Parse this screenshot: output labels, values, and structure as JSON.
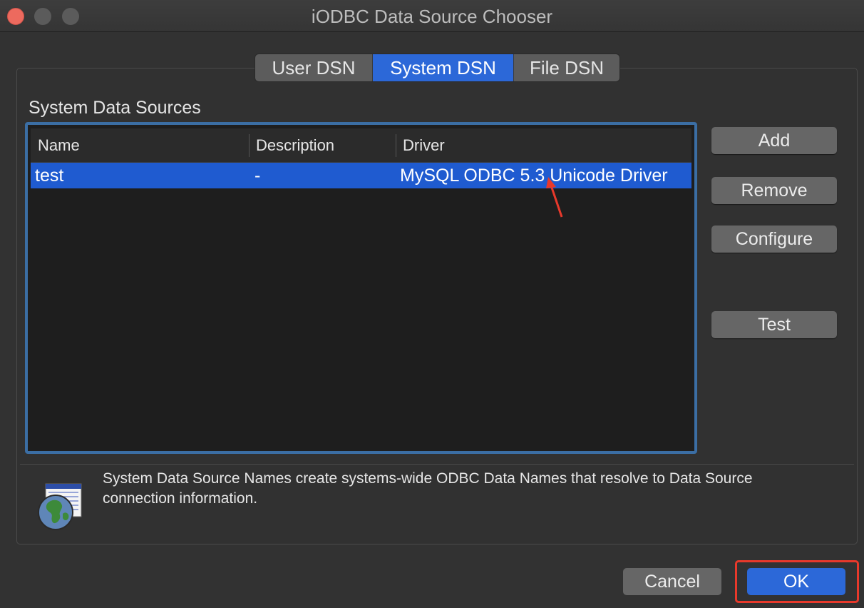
{
  "window": {
    "title": "iODBC Data Source Chooser"
  },
  "tabs": [
    {
      "label": "User DSN",
      "selected": false
    },
    {
      "label": "System DSN",
      "selected": true
    },
    {
      "label": "File DSN",
      "selected": false
    }
  ],
  "section": {
    "label": "System Data Sources"
  },
  "table": {
    "columns": [
      "Name",
      "Description",
      "Driver"
    ],
    "rows": [
      {
        "name": "test",
        "description": "-",
        "driver": "MySQL ODBC 5.3 Unicode Driver",
        "selected": true
      }
    ]
  },
  "side_buttons": {
    "add": "Add",
    "remove": "Remove",
    "configure": "Configure",
    "test": "Test"
  },
  "info": {
    "text": "System Data Source Names create systems-wide ODBC Data Names that resolve to Data Source connection information.",
    "icon": "odbc-globe-icon"
  },
  "footer": {
    "cancel": "Cancel",
    "ok": "OK"
  },
  "colors": {
    "accent": "#2c68d8",
    "selection": "#1f5bd0",
    "annotation": "#e8392b"
  }
}
